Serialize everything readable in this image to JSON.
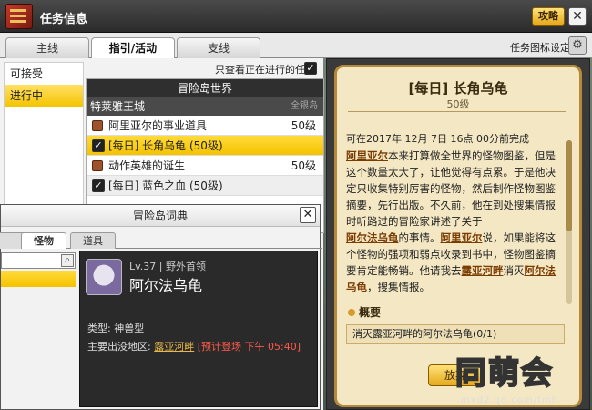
{
  "window": {
    "title": "任务信息",
    "guide_label": "攻略",
    "close_label": "✕"
  },
  "tabs": [
    {
      "label": "主线"
    },
    {
      "label": "指引/活动"
    },
    {
      "label": "支线"
    }
  ],
  "tab_settings": {
    "label": "任务图标设定",
    "icon": "gear-icon"
  },
  "status": [
    {
      "label": "可接受"
    },
    {
      "label": "进行中"
    }
  ],
  "only_running": {
    "label": "只查看正在进行的任务",
    "checked": true
  },
  "quest_list": {
    "region": "冒险岛世界",
    "subregion": "特莱雅王城",
    "subregion_note": "全银岛",
    "quests": [
      {
        "name": "阿里亚尔的事业道具",
        "level": "50级"
      },
      {
        "name": "[每日] 长角乌龟  (50级)",
        "level": ""
      },
      {
        "name": "动作英雄的诞生",
        "level": "50级"
      },
      {
        "name": "[每日] 蓝色之血  (50级)",
        "level": ""
      }
    ]
  },
  "dictionary": {
    "title": "冒险岛词典",
    "close_label": "✕",
    "tabs": [
      {
        "label": "怪物"
      },
      {
        "label": "道具"
      }
    ],
    "monster": {
      "level_line": "Lv.37 | 野外首领",
      "name": "阿尔法乌龟",
      "type_line": "类型:  神兽型",
      "area_label": "主要出没地区:",
      "area_link": "露亚河畔",
      "area_note": "[预计登场 下午 05:40]"
    }
  },
  "detail": {
    "title": "[每日] 长角乌龟",
    "level": "50级",
    "time": "可在2017年 12月 7日 16点 00分前完成",
    "text_parts": [
      {
        "t": "阿里亚尔",
        "hl": true
      },
      {
        "t": "本来打算做全世界的怪物图鉴，但是这个数量太大了，让他觉得有点累。于是他决定只收集特别厉害的怪物，然后制作怪物图鉴摘要，先行出版。",
        "hl": false
      },
      {
        "t": "不久前，他在到处搜集情报时听路过的冒险家讲述了关于",
        "hl": false
      },
      {
        "t": "阿尔法乌龟",
        "hl": true
      },
      {
        "t": "的事情。",
        "hl": false
      },
      {
        "t": "阿里亚尔",
        "hl": true
      },
      {
        "t": "说，如果能将这个怪物的强项和弱点收录到书中，怪物图鉴摘要肯定能畅销。他请我去",
        "hl": false
      },
      {
        "t": "露亚河畔",
        "hl": true
      },
      {
        "t": "消灭",
        "hl": false
      },
      {
        "t": "阿尔法乌龟",
        "hl": true
      },
      {
        "t": "，搜集情报。",
        "hl": false
      }
    ],
    "overview_label": "概要",
    "objective": "消灭露亚河畔的阿尔法乌龟(0/1)",
    "abandon_label": "放弃"
  },
  "watermark": {
    "text": "同萌会",
    "url": "mxd2.qq.com/tmh"
  }
}
